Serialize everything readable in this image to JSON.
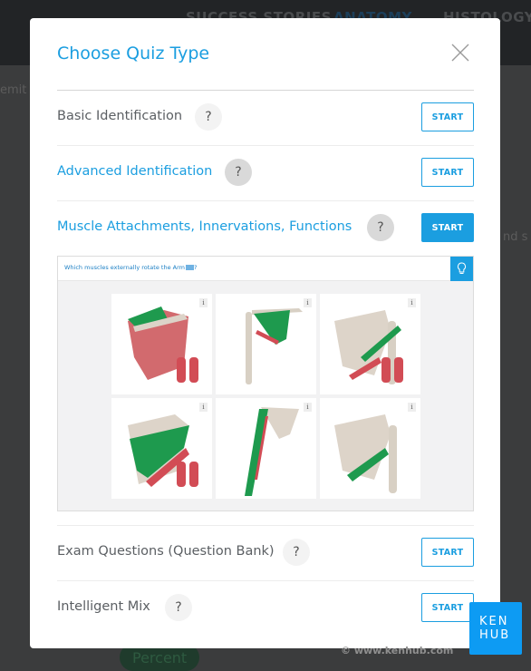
{
  "background": {
    "nav": [
      "SUCCESS STORIES",
      "ANATOMY",
      "HISTOLOGY"
    ],
    "fragments": [
      "emit",
      "nd s"
    ],
    "pill": "Percent"
  },
  "modal": {
    "title": "Choose Quiz Type",
    "close_icon": "close-icon",
    "options": [
      {
        "label": "Basic Identification",
        "help": "?",
        "start": "START"
      },
      {
        "label": "Advanced Identification",
        "help": "?",
        "start": "START"
      },
      {
        "label": "Muscle Attachments, Innervations, Functions",
        "help": "?",
        "start": "START"
      },
      {
        "label": "Exam Questions (Question Bank)",
        "help": "?",
        "start": "START"
      },
      {
        "label": "Intelligent Mix",
        "help": "?",
        "start": "START"
      }
    ],
    "preview": {
      "question": "Which muscles externally rotate the Arm",
      "question_suffix": "?",
      "hint_icon": "lightbulb-icon",
      "tile_info": "i"
    }
  },
  "watermark": "© www.kenhub.com",
  "logo": {
    "line1": "KEN",
    "line2": "HUB"
  },
  "colors": {
    "accent": "#1b9ee0",
    "logo": "#0d9bf3",
    "muscle_highlight": "#1e9a4e",
    "muscle": "#d4565f"
  }
}
